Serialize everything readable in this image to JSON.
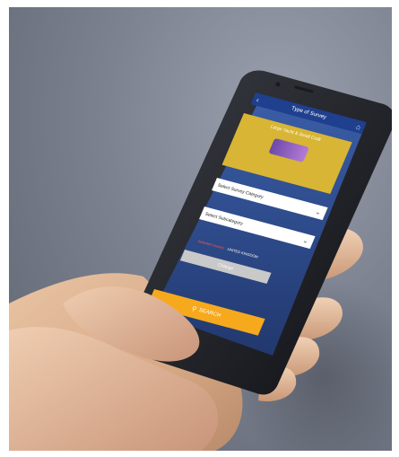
{
  "app": {
    "title": "Type of Survey",
    "banner_caption": "Large Yacht & Small Craft",
    "survey_category_placeholder": "Select Survey Category",
    "subcategory_placeholder": "Select Subcategory",
    "selected_country_label": "Selected country:",
    "selected_country_value": "UNITED KINGDOM",
    "change_button": "Change",
    "search_button": "SEARCH"
  },
  "colors": {
    "nav_bar": "#1f3f8f",
    "banner": "#d8b534",
    "screen_bg": "#2d4b8d",
    "search_button": "#f6a91c",
    "country_label": "#ff5a4a",
    "change_button": "#c9c9c9"
  },
  "icons": [
    "back-arrow-icon",
    "home-icon",
    "chevron-down-icon",
    "search-icon",
    "yacht-icon"
  ]
}
